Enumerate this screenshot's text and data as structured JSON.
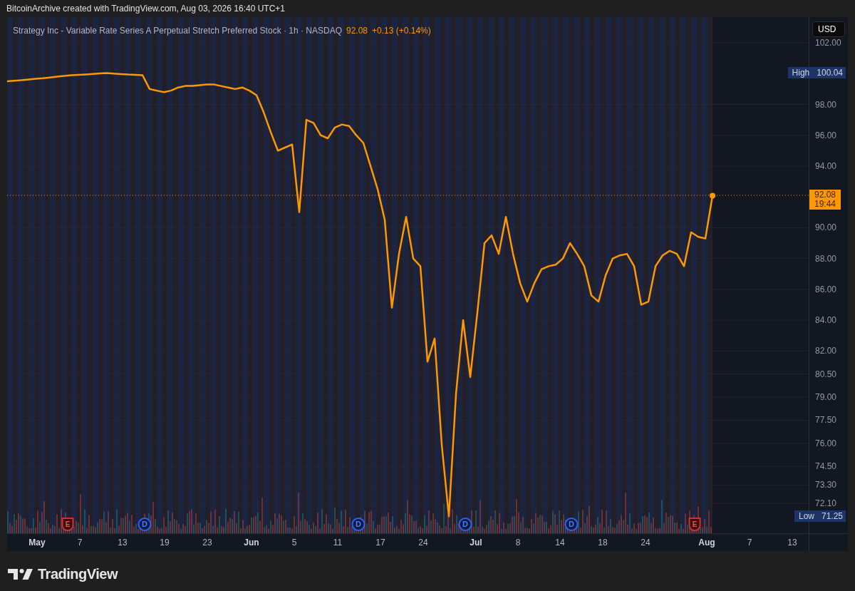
{
  "header": {
    "caption": "BitcoinArchive created with TradingView.com, Aug 03, 2026 16:40 UTC+1"
  },
  "legend": {
    "title": "Strategy Inc - Variable Rate Series A Perpetual Stretch Preferred Stock · 1h · NASDAQ",
    "price": "92.08",
    "change": "+0.13 (+0.14%)"
  },
  "currency": "USD",
  "chart": {
    "chart_data": {
      "type": "line",
      "categories": [
        null,
        null,
        null,
        null,
        null,
        null,
        null,
        null,
        null,
        null,
        null,
        null,
        null,
        null,
        null,
        null,
        null,
        null,
        null,
        null,
        null,
        null,
        null,
        null,
        null,
        null,
        null,
        null,
        null,
        null,
        null,
        null,
        null,
        null,
        null,
        null,
        null,
        null,
        null,
        null,
        null,
        null,
        null,
        null,
        null,
        null,
        null,
        null,
        null,
        null,
        null,
        null,
        null,
        null,
        null,
        null,
        null,
        null,
        null,
        null,
        null,
        null,
        null,
        null,
        null,
        null,
        null,
        null,
        null,
        null,
        null,
        null,
        null,
        null,
        null,
        null,
        null,
        null,
        null,
        null,
        null,
        null,
        null,
        null,
        null,
        null,
        null,
        null,
        null,
        null,
        null,
        null,
        null,
        null,
        null,
        null,
        null,
        null,
        null,
        null
      ],
      "series": [
        {
          "color": "#ff9800",
          "values": [
            99.5,
            99.54,
            99.58,
            99.62,
            99.66,
            99.7,
            99.75,
            99.8,
            99.85,
            99.9,
            99.92,
            99.95,
            99.98,
            100.01,
            100.04,
            100.0,
            99.97,
            99.94,
            99.92,
            99.9,
            99.0,
            98.9,
            98.8,
            98.9,
            99.1,
            99.2,
            99.2,
            99.25,
            99.3,
            99.3,
            99.2,
            99.1,
            99.0,
            99.1,
            98.9,
            98.6,
            97.5,
            96.2,
            95.0,
            95.2,
            95.4,
            91.0,
            97.0,
            96.8,
            96.0,
            95.8,
            96.5,
            96.7,
            96.6,
            96.0,
            95.5,
            94.0,
            92.5,
            90.5,
            84.8,
            88.3,
            90.7,
            88.0,
            87.5,
            81.3,
            82.8,
            75.9,
            71.25,
            79.2,
            84.0,
            80.3,
            84.5,
            89.0,
            89.5,
            88.3,
            90.7,
            88.3,
            86.4,
            85.2,
            86.4,
            87.3,
            87.5,
            87.6,
            88.0,
            89.0,
            88.3,
            87.5,
            85.6,
            85.2,
            86.9,
            88.0,
            88.2,
            88.3,
            87.5,
            85.0,
            85.2,
            87.5,
            88.2,
            88.5,
            88.3,
            87.5,
            89.7,
            89.4,
            89.3,
            92.08
          ]
        }
      ],
      "ylim": [
        70.16,
        103.67
      ],
      "grid": true,
      "yticks": [
        {
          "value": 102,
          "label": "102.00"
        },
        {
          "value": 98,
          "label": "98.00"
        },
        {
          "value": 96,
          "label": "96.00"
        },
        {
          "value": 94,
          "label": "94.00"
        },
        {
          "value": 90,
          "label": "90.00"
        },
        {
          "value": 88,
          "label": "88.00"
        },
        {
          "value": 86,
          "label": "86.00"
        },
        {
          "value": 84,
          "label": "84.00"
        },
        {
          "value": 82,
          "label": "82.00"
        },
        {
          "value": 80.5,
          "label": "80.50"
        },
        {
          "value": 79,
          "label": "79.00"
        },
        {
          "value": 77.5,
          "label": "77.50"
        },
        {
          "value": 76,
          "label": "76.00"
        },
        {
          "value": 74.5,
          "label": "74.50"
        },
        {
          "value": 73.3,
          "label": "73.30"
        },
        {
          "value": 72.1,
          "label": "72.10"
        }
      ]
    },
    "high_tag": {
      "label": "High",
      "value": "100.04"
    },
    "low_tag": {
      "label": "Low",
      "value": "71.25"
    },
    "last_tag": {
      "price": "92.08",
      "countdown": "19:44"
    },
    "events": [
      {
        "kind": "earnings",
        "label": "E"
      },
      {
        "kind": "dividend",
        "label": "D"
      },
      {
        "kind": "dividend",
        "label": "D"
      },
      {
        "kind": "dividend",
        "label": "D"
      },
      {
        "kind": "dividend",
        "label": "D"
      },
      {
        "kind": "earnings",
        "label": "E"
      }
    ],
    "time_axis": [
      {
        "label": "May",
        "kind": "month"
      },
      {
        "label": "7",
        "kind": "day"
      },
      {
        "label": "13",
        "kind": "day"
      },
      {
        "label": "19",
        "kind": "day"
      },
      {
        "label": "23",
        "kind": "day"
      },
      {
        "label": "Jun",
        "kind": "month"
      },
      {
        "label": "5",
        "kind": "day"
      },
      {
        "label": "11",
        "kind": "day"
      },
      {
        "label": "17",
        "kind": "day"
      },
      {
        "label": "24",
        "kind": "day"
      },
      {
        "label": "Jul",
        "kind": "month"
      },
      {
        "label": "8",
        "kind": "day"
      },
      {
        "label": "14",
        "kind": "day"
      },
      {
        "label": "18",
        "kind": "day"
      },
      {
        "label": "24",
        "kind": "day"
      },
      {
        "label": "Aug",
        "kind": "month"
      },
      {
        "label": "7",
        "kind": "day"
      },
      {
        "label": "13",
        "kind": "day"
      }
    ]
  },
  "footer": {
    "brand": "TradingView"
  }
}
